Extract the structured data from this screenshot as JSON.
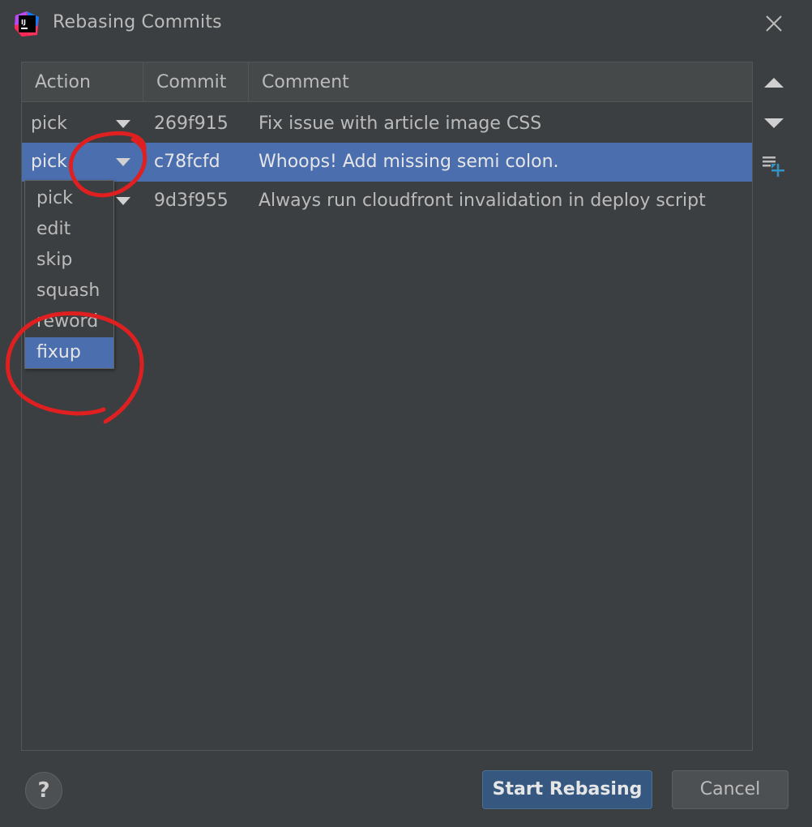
{
  "window": {
    "title": "Rebasing Commits"
  },
  "table": {
    "columns": {
      "action": "Action",
      "commit": "Commit",
      "comment": "Comment"
    },
    "rows": [
      {
        "action": "pick",
        "commit": "269f915",
        "comment": "Fix issue with article image CSS"
      },
      {
        "action": "pick",
        "commit": "c78fcfd",
        "comment": "Whoops! Add missing semi colon."
      },
      {
        "action": "",
        "commit": "9d3f955",
        "comment": "Always run cloudfront invalidation in deploy script"
      }
    ],
    "selected_row": 1
  },
  "dropdown": {
    "options": [
      "pick",
      "edit",
      "skip",
      "squash",
      "reword",
      "fixup"
    ],
    "selected": "fixup"
  },
  "buttons": {
    "help": "?",
    "start": "Start Rebasing",
    "cancel": "Cancel"
  },
  "icons": {
    "app": "intellij-idea-icon",
    "close": "close-icon",
    "move_up": "move-up-icon",
    "move_down": "move-down-icon",
    "unite": "unite-commits-icon"
  },
  "colors": {
    "background": "#3c3f41",
    "selection": "#4b6eaf",
    "primary_button": "#365880",
    "annotation": "#e02020"
  }
}
